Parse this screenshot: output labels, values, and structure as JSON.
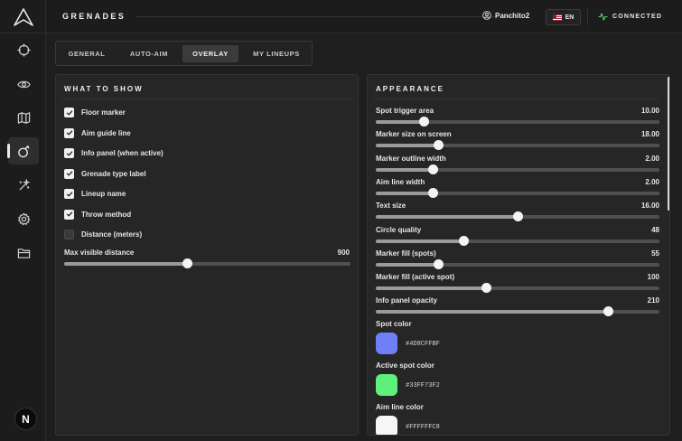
{
  "header": {
    "title": "GRENADES",
    "user_name": "Panchito2",
    "language": "EN",
    "status": "CONNECTED"
  },
  "sidebar": {
    "items": [
      {
        "name": "crosshair-icon"
      },
      {
        "name": "eye-icon"
      },
      {
        "name": "map-icon"
      },
      {
        "name": "grenade-icon",
        "active": true
      },
      {
        "name": "wand-icon"
      },
      {
        "name": "gear-icon"
      },
      {
        "name": "folder-icon"
      }
    ],
    "footer_badge": "N"
  },
  "tabs": [
    {
      "label": "GENERAL"
    },
    {
      "label": "AUTO-AIM"
    },
    {
      "label": "OVERLAY",
      "active": true
    },
    {
      "label": "MY LINEUPS"
    }
  ],
  "what_to_show": {
    "title": "WHAT TO SHOW",
    "options": [
      {
        "label": "Floor marker",
        "checked": true
      },
      {
        "label": "Aim guide line",
        "checked": true
      },
      {
        "label": "Info panel (when active)",
        "checked": true
      },
      {
        "label": "Grenade type label",
        "checked": true
      },
      {
        "label": "Lineup name",
        "checked": true
      },
      {
        "label": "Throw method",
        "checked": true
      },
      {
        "label": "Distance (meters)",
        "checked": false
      }
    ],
    "max_distance": {
      "label": "Max visible distance",
      "value": "900",
      "fraction": 0.43
    }
  },
  "appearance": {
    "title": "APPEARANCE",
    "sliders": [
      {
        "label": "Spot trigger area",
        "value": "10.00",
        "fraction": 0.17
      },
      {
        "label": "Marker size on screen",
        "value": "18.00",
        "fraction": 0.22
      },
      {
        "label": "Marker outline width",
        "value": "2.00",
        "fraction": 0.2
      },
      {
        "label": "Aim line width",
        "value": "2.00",
        "fraction": 0.2
      },
      {
        "label": "Text size",
        "value": "16.00",
        "fraction": 0.5
      },
      {
        "label": "Circle quality",
        "value": "48",
        "fraction": 0.31
      },
      {
        "label": "Marker fill (spots)",
        "value": "55",
        "fraction": 0.22
      },
      {
        "label": "Marker fill (active spot)",
        "value": "100",
        "fraction": 0.39
      },
      {
        "label": "Info panel opacity",
        "value": "210",
        "fraction": 0.82
      }
    ],
    "colors": [
      {
        "label": "Spot color",
        "hex": "#4D8CFFBF",
        "swatch": "#6f7ff5"
      },
      {
        "label": "Active spot color",
        "hex": "#33FF73F2",
        "swatch": "#5fef7c"
      },
      {
        "label": "Aim line color",
        "hex": "#FFFFFFC8",
        "swatch": "#f6f6f6"
      }
    ]
  }
}
